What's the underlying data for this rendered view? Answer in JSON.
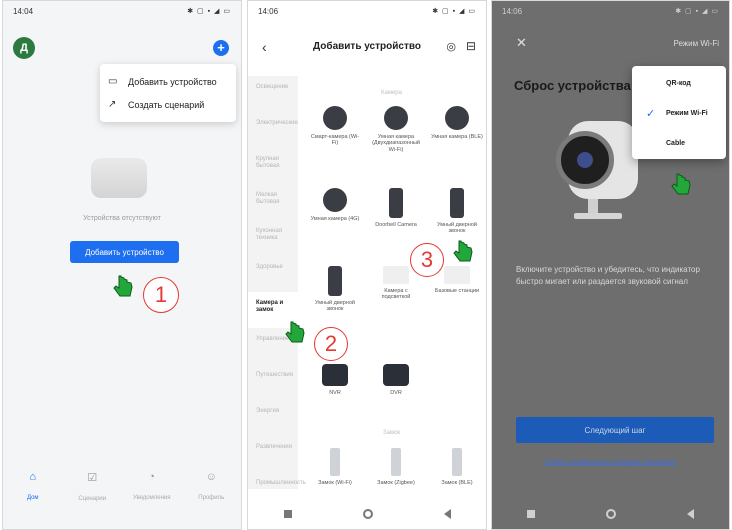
{
  "colors": {
    "accent": "#1e6ef0",
    "badge_red": "#e53935",
    "hand_green": "#22a83a"
  },
  "phone1": {
    "time": "14:04",
    "status_icons": "✱ ▢ ▪ ◢ ▭",
    "avatar_letter": "Д",
    "menu": {
      "add_device": "Добавить устройство",
      "create_scenario": "Создать сценарий"
    },
    "empty_text": "Устройства отсутствуют",
    "add_button": "Добавить устройство",
    "badge": "1",
    "nav": [
      {
        "label": "Дом",
        "icon": "home-icon"
      },
      {
        "label": "Сценарии",
        "icon": "scenario-icon"
      },
      {
        "label": "Уведомления",
        "icon": "notify-icon"
      },
      {
        "label": "Профиль",
        "icon": "profile-icon"
      }
    ]
  },
  "phone2": {
    "time": "14:06",
    "status_icons": "✱ ▢ ▪ ◢ ▭",
    "title": "Добавить устройство",
    "categories": [
      "Освещение",
      "Электрические",
      "Крупная бытовая",
      "Мелкая бытовая",
      "Кухонная техника",
      "Здоровье",
      "Камера и замок",
      "Управление",
      "Путешествия",
      "Энергия",
      "Развлечения",
      "Промышленность"
    ],
    "section_top": "Камера",
    "section_bottom": "Замок",
    "devices": [
      "Смарт-камера (Wi-Fi)",
      "Умная камера (Двухдиапазонный Wi-Fi)",
      "Умная камера (BLE)",
      "Умная камера (4G)",
      "Doorbell Camera",
      "Умный дверной звонок",
      "Умный дверной звонок",
      "Камера с подсветкой",
      "Базовые станции",
      "NVR",
      "DVR",
      "Замок (Wi-Fi)",
      "Замок (Zigbee)",
      "Замок (BLE)"
    ],
    "badge_camera": "2",
    "badge_device": "3"
  },
  "phone3": {
    "time": "14:06",
    "status_icons": "✱ ▢ ▪ ◢ ▭",
    "mode_button": "Режим Wi-Fi",
    "title": "Сброс устройства",
    "menu_options": [
      "QR-код",
      "Режим Wi-Fi",
      "Cable"
    ],
    "selected_option": "Режим Wi-Fi",
    "description": "Включите устройство и убедитесь, что индикатор быстро мигает или раздается звуковой сигнал",
    "next_button": "Следующий шаг",
    "link": "Сброс устройства в исходное состояние"
  }
}
